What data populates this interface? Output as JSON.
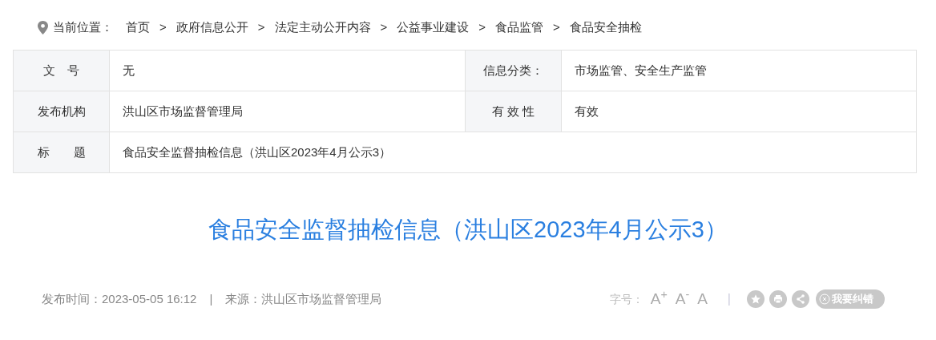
{
  "breadcrumb": [
    {
      "kind": "label",
      "text": "当前位置："
    },
    {
      "kind": "link",
      "text": "首页"
    },
    {
      "kind": "sep",
      "text": ">"
    },
    {
      "kind": "link",
      "text": "政府信息公开"
    },
    {
      "kind": "sep",
      "text": ">"
    },
    {
      "kind": "link",
      "text": "法定主动公开内容"
    },
    {
      "kind": "sep",
      "text": ">"
    },
    {
      "kind": "link",
      "text": "公益事业建设"
    },
    {
      "kind": "sep",
      "text": ">"
    },
    {
      "kind": "link",
      "text": "食品监管"
    },
    {
      "kind": "sep",
      "text": ">"
    },
    {
      "kind": "link",
      "text": "食品安全抽检"
    }
  ],
  "info_table": {
    "rows": [
      [
        {
          "label": "文　号",
          "value": "无"
        },
        {
          "label": "信息分类：",
          "value": "市场监管、安全生产监管"
        }
      ],
      [
        {
          "label": "发布机构",
          "value": "洪山区市场监督管理局"
        },
        {
          "label": "有 效 性",
          "value": "有效"
        }
      ],
      [
        {
          "label": "标　　题",
          "value": "食品安全监督抽检信息（洪山区2023年4月公示3）"
        }
      ]
    ]
  },
  "title": "食品安全监督抽检信息（洪山区2023年4月公示3）",
  "meta": {
    "publish_time": "发布时间：2023-05-05 16:12",
    "divider": "|",
    "source": "来源：洪山区市场监督管理局"
  },
  "tools": {
    "font_label": "字号：",
    "font_sizes": [
      "A$^{+}$",
      "A$^{-}$",
      "A"
    ],
    "divider": "|",
    "correction": "我要纠错"
  }
}
